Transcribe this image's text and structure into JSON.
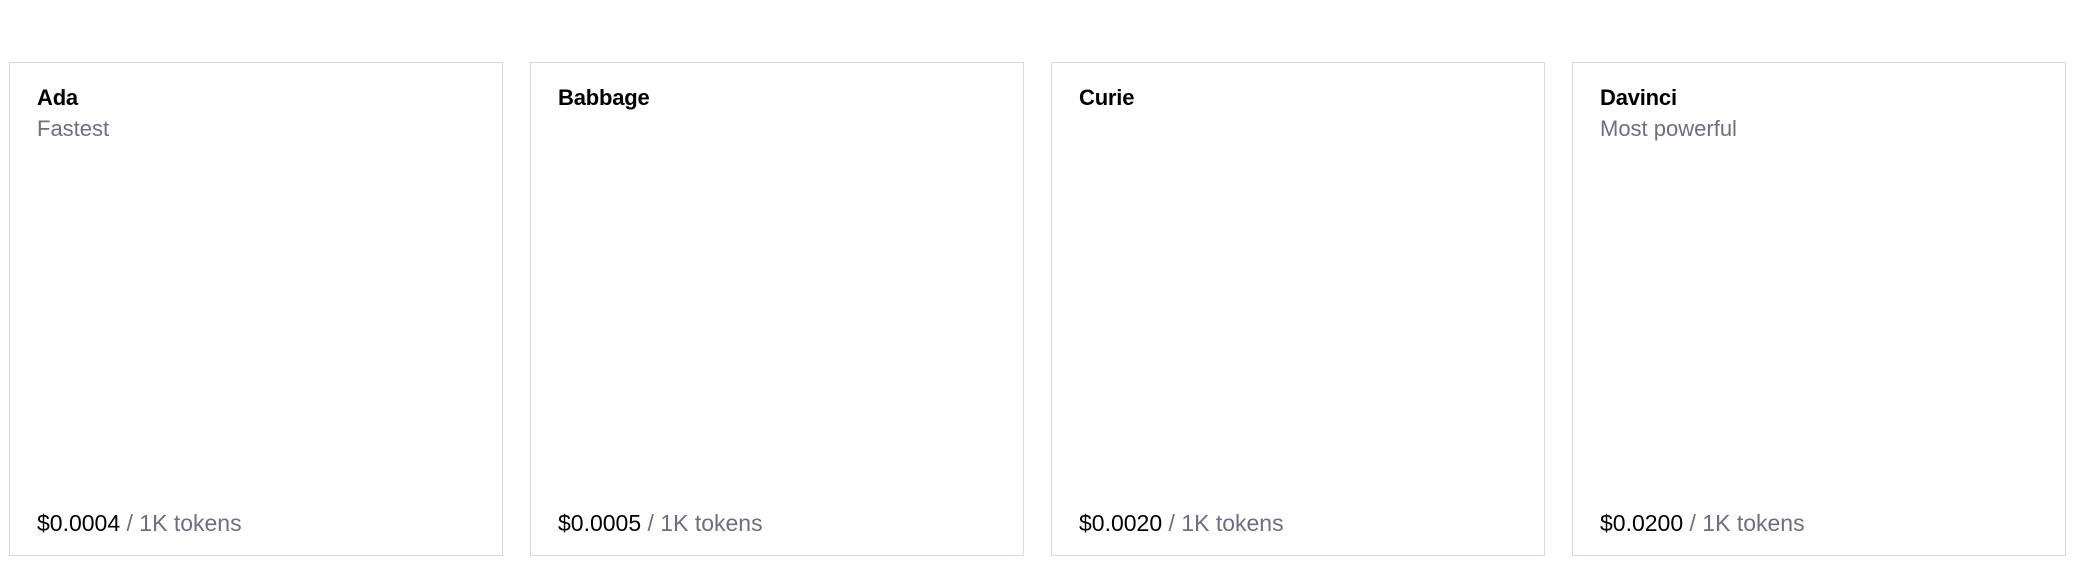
{
  "models": [
    {
      "name": "Ada",
      "tagline": "Fastest",
      "price": "$0.0004",
      "unit": " / 1K tokens"
    },
    {
      "name": "Babbage",
      "tagline": "",
      "price": "$0.0005",
      "unit": " / 1K tokens"
    },
    {
      "name": "Curie",
      "tagline": "",
      "price": "$0.0020",
      "unit": " / 1K tokens"
    },
    {
      "name": "Davinci",
      "tagline": "Most powerful",
      "price": "$0.0200",
      "unit": " / 1K tokens"
    }
  ]
}
